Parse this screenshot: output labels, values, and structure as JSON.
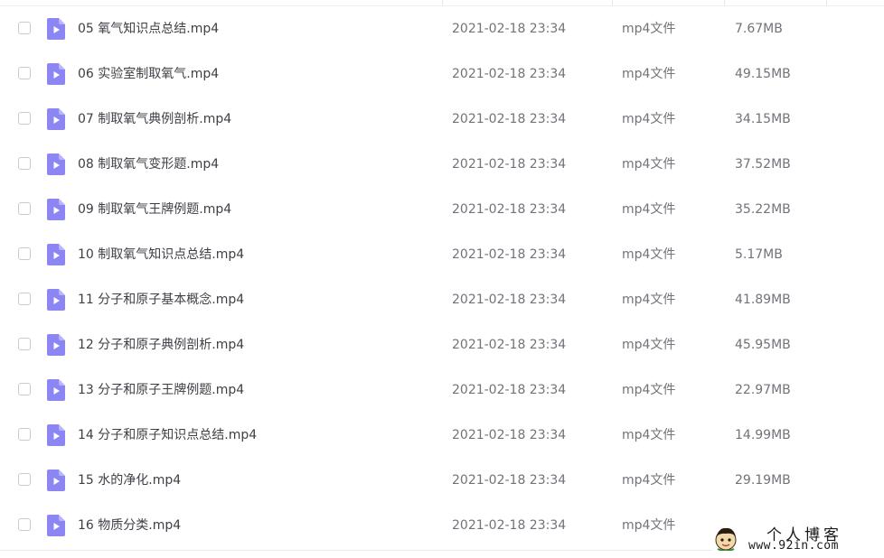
{
  "colors": {
    "file_icon": "#8b86f3",
    "text_primary": "#3d3f45",
    "text_secondary": "#707379",
    "checkbox_border": "#c9cbd1"
  },
  "file_icon_name": "video-file-icon",
  "files": [
    {
      "name": "05 氧气知识点总结.mp4",
      "date": "2021-02-18 23:34",
      "type": "mp4文件",
      "size": "7.67MB"
    },
    {
      "name": "06 实验室制取氧气.mp4",
      "date": "2021-02-18 23:34",
      "type": "mp4文件",
      "size": "49.15MB"
    },
    {
      "name": "07 制取氧气典例剖析.mp4",
      "date": "2021-02-18 23:34",
      "type": "mp4文件",
      "size": "34.15MB"
    },
    {
      "name": "08 制取氧气变形题.mp4",
      "date": "2021-02-18 23:34",
      "type": "mp4文件",
      "size": "37.52MB"
    },
    {
      "name": "09 制取氧气王牌例题.mp4",
      "date": "2021-02-18 23:34",
      "type": "mp4文件",
      "size": "35.22MB"
    },
    {
      "name": "10 制取氧气知识点总结.mp4",
      "date": "2021-02-18 23:34",
      "type": "mp4文件",
      "size": "5.17MB"
    },
    {
      "name": "11 分子和原子基本概念.mp4",
      "date": "2021-02-18 23:34",
      "type": "mp4文件",
      "size": "41.89MB"
    },
    {
      "name": "12 分子和原子典例剖析.mp4",
      "date": "2021-02-18 23:34",
      "type": "mp4文件",
      "size": "45.95MB"
    },
    {
      "name": "13 分子和原子王牌例题.mp4",
      "date": "2021-02-18 23:34",
      "type": "mp4文件",
      "size": "22.97MB"
    },
    {
      "name": "14 分子和原子知识点总结.mp4",
      "date": "2021-02-18 23:34",
      "type": "mp4文件",
      "size": "14.99MB"
    },
    {
      "name": "15 水的净化.mp4",
      "date": "2021-02-18 23:34",
      "type": "mp4文件",
      "size": "29.19MB"
    },
    {
      "name": "16 物质分类.mp4",
      "date": "2021-02-18 23:34",
      "type": "mp4文件",
      "size": ""
    }
  ],
  "watermark": {
    "title": "个人博客",
    "url": "www.92in.com"
  }
}
